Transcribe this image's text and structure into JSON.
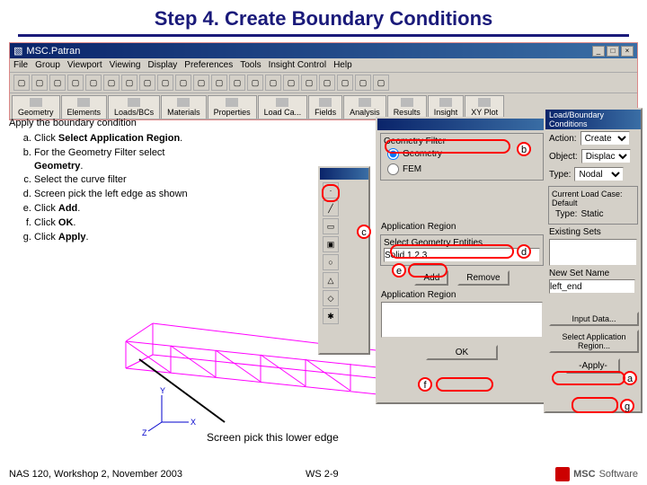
{
  "title": "Step 4. Create Boundary Conditions",
  "window_title": "MSC.Patran",
  "menu": [
    "File",
    "Group",
    "Viewport",
    "Viewing",
    "Display",
    "Preferences",
    "Tools",
    "Insight Control",
    "Help"
  ],
  "tabs": [
    "Geometry",
    "Elements",
    "Loads/BCs",
    "Materials",
    "Properties",
    "Load Ca...",
    "Fields",
    "Analysis",
    "Results",
    "Insight",
    "XY Plot"
  ],
  "instructions": {
    "lead": "Apply the boundary condition",
    "items": [
      {
        "pre": "Click ",
        "b": "Select Application Region",
        "post": "."
      },
      {
        "pre": "For the Geometry Filter select ",
        "b": "Geometry",
        "post": "."
      },
      {
        "pre": "Select the curve filter",
        "b": "",
        "post": ""
      },
      {
        "pre": "Screen pick the left edge as shown",
        "b": "",
        "post": ""
      },
      {
        "pre": "Click ",
        "b": "Add",
        "post": "."
      },
      {
        "pre": "Click ",
        "b": "OK",
        "post": "."
      },
      {
        "pre": "Click ",
        "b": "Apply",
        "post": "."
      }
    ]
  },
  "lbc": {
    "title": "Load/Boundary Conditions",
    "action_label": "Action:",
    "action": "Create",
    "object_label": "Object:",
    "object": "Displacement",
    "type_label": "Type:",
    "type": "Nodal",
    "current_load_case_label": "Current Load Case:",
    "current_load_case": "Default",
    "load_type_label": "Type:",
    "load_type": "Static",
    "existing_sets_label": "Existing Sets",
    "newset_label": "New Set Name",
    "newset": "left_end",
    "input_data": "Input Data...",
    "select_region": "Select Application Region...",
    "apply": "-Apply-"
  },
  "app_region": {
    "geom_filter_label": "Geometry Filter",
    "geom_opt1": "Geometry",
    "geom_opt2": "FEM",
    "app_region_label": "Application Region",
    "select_label": "Select Geometry Entities",
    "select_value": "Solid 1.2.3",
    "add": "Add",
    "remove": "Remove",
    "app_region_box_label": "Application Region",
    "ok": "OK"
  },
  "markers": {
    "a": "a",
    "b": "b",
    "c": "c",
    "d": "d",
    "e": "e",
    "f": "f",
    "g": "g"
  },
  "lower_caption": "Screen pick this lower edge",
  "footer_left": "NAS 120, Workshop 2, November 2003",
  "footer_center": "WS 2-9",
  "footer_right": "Software"
}
